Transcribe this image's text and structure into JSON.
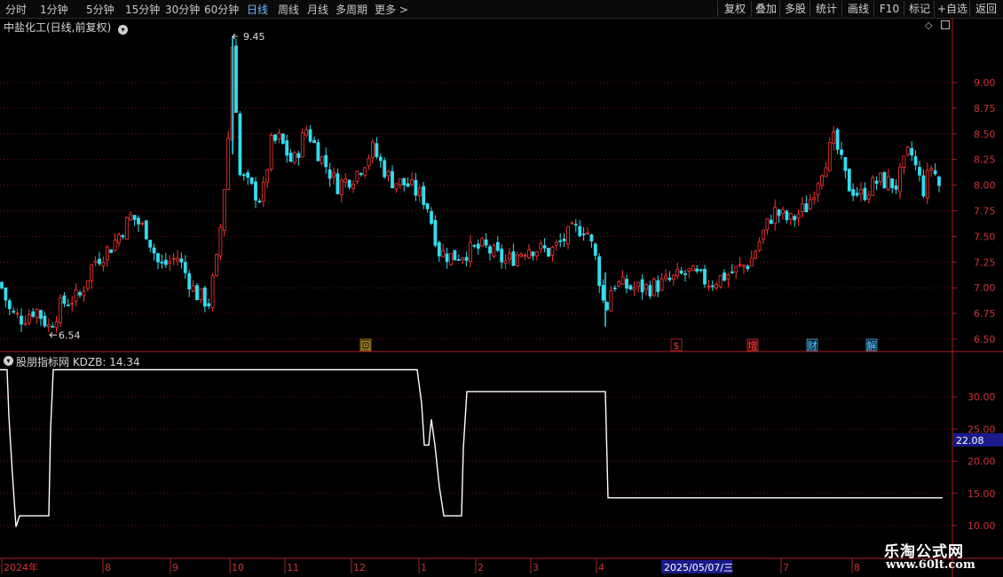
{
  "toolbar": {
    "periods": [
      "分时",
      "1分钟",
      "5分钟",
      "15分钟",
      "30分钟",
      "60分钟",
      "日线",
      "周线",
      "月线",
      "多周期",
      "更多 >"
    ],
    "active_period": "日线",
    "right_buttons": [
      "复权",
      "叠加",
      "多股",
      "统计",
      "画线",
      "F10",
      "标记",
      "+自选",
      "返回"
    ]
  },
  "main_panel": {
    "title": "中盐化工(日线,前复权)",
    "high_label": "9.45",
    "low_label": "6.54",
    "event_markers": [
      "回",
      "$",
      "增",
      "财",
      "解"
    ]
  },
  "sub_panel": {
    "indicator_label": "股朋指标网 KDZB: 14.34",
    "current_value_badge": "22.08"
  },
  "time_axis": {
    "labels": [
      "2024年",
      "8",
      "9",
      "10",
      "11",
      "12",
      "1",
      "2",
      "3",
      "4",
      "7",
      "8"
    ],
    "cursor_date": "2025/05/07/三"
  },
  "colors": {
    "up": "#ff3333",
    "down": "#33ddee",
    "line": "#ffffff",
    "axis": "#cc2222",
    "badge": "#1a1a8a"
  },
  "watermark": {
    "line1": "乐淘公式网",
    "line2": "www.60lt.com"
  },
  "chart_data": [
    {
      "type": "candlestick",
      "title": "中盐化工(日线,前复权)",
      "yticks": [
        6.5,
        6.75,
        7.0,
        7.25,
        7.5,
        7.75,
        8.0,
        8.25,
        8.5,
        8.75,
        9.0
      ],
      "ylim": [
        6.4,
        9.5
      ],
      "grid": true,
      "annotations": [
        {
          "label": "9.45",
          "value": 9.45
        },
        {
          "label": "6.54",
          "value": 6.54
        }
      ],
      "close_path": [
        {
          "x": 0,
          "y": 7.05
        },
        {
          "x": 12,
          "y": 6.75
        },
        {
          "x": 25,
          "y": 6.7
        },
        {
          "x": 40,
          "y": 6.8
        },
        {
          "x": 55,
          "y": 6.62
        },
        {
          "x": 70,
          "y": 6.85
        },
        {
          "x": 90,
          "y": 6.92
        },
        {
          "x": 105,
          "y": 7.25
        },
        {
          "x": 125,
          "y": 7.4
        },
        {
          "x": 148,
          "y": 7.7
        },
        {
          "x": 165,
          "y": 7.55
        },
        {
          "x": 180,
          "y": 7.2
        },
        {
          "x": 200,
          "y": 7.3
        },
        {
          "x": 220,
          "y": 6.95
        },
        {
          "x": 235,
          "y": 6.85
        },
        {
          "x": 245,
          "y": 7.3
        },
        {
          "x": 252,
          "y": 7.9
        },
        {
          "x": 258,
          "y": 8.55
        },
        {
          "x": 262,
          "y": 9.45
        },
        {
          "x": 270,
          "y": 8.1
        },
        {
          "x": 285,
          "y": 7.95
        },
        {
          "x": 295,
          "y": 7.85
        },
        {
          "x": 305,
          "y": 8.4
        },
        {
          "x": 315,
          "y": 8.45
        },
        {
          "x": 330,
          "y": 8.2
        },
        {
          "x": 345,
          "y": 8.55
        },
        {
          "x": 360,
          "y": 8.3
        },
        {
          "x": 380,
          "y": 8.0
        },
        {
          "x": 400,
          "y": 8.1
        },
        {
          "x": 420,
          "y": 8.35
        },
        {
          "x": 440,
          "y": 8.05
        },
        {
          "x": 460,
          "y": 8.0
        },
        {
          "x": 480,
          "y": 7.85
        },
        {
          "x": 495,
          "y": 7.35
        },
        {
          "x": 510,
          "y": 7.3
        },
        {
          "x": 525,
          "y": 7.35
        },
        {
          "x": 545,
          "y": 7.4
        },
        {
          "x": 570,
          "y": 7.25
        },
        {
          "x": 595,
          "y": 7.4
        },
        {
          "x": 620,
          "y": 7.35
        },
        {
          "x": 645,
          "y": 7.55
        },
        {
          "x": 660,
          "y": 7.6
        },
        {
          "x": 672,
          "y": 7.25
        },
        {
          "x": 682,
          "y": 6.75
        },
        {
          "x": 690,
          "y": 7.05
        },
        {
          "x": 710,
          "y": 7.0
        },
        {
          "x": 730,
          "y": 7.0
        },
        {
          "x": 750,
          "y": 7.05
        },
        {
          "x": 775,
          "y": 7.15
        },
        {
          "x": 800,
          "y": 7.05
        },
        {
          "x": 825,
          "y": 7.15
        },
        {
          "x": 845,
          "y": 7.25
        },
        {
          "x": 858,
          "y": 7.5
        },
        {
          "x": 872,
          "y": 7.75
        },
        {
          "x": 890,
          "y": 7.65
        },
        {
          "x": 910,
          "y": 7.8
        },
        {
          "x": 925,
          "y": 8.15
        },
        {
          "x": 940,
          "y": 8.45
        },
        {
          "x": 955,
          "y": 8.0
        },
        {
          "x": 970,
          "y": 7.9
        },
        {
          "x": 990,
          "y": 8.05
        },
        {
          "x": 1010,
          "y": 8.0
        },
        {
          "x": 1025,
          "y": 8.35
        },
        {
          "x": 1040,
          "y": 7.95
        },
        {
          "x": 1050,
          "y": 8.2
        },
        {
          "x": 1062,
          "y": 7.9
        }
      ]
    },
    {
      "type": "line",
      "title": "股朋指标网 KDZB: 14.34",
      "yticks": [
        10.0,
        15.0,
        20.0,
        25.0,
        30.0
      ],
      "ylim": [
        8,
        36
      ],
      "grid": true,
      "series": [
        {
          "name": "KDZB",
          "x": [
            0,
            8,
            10,
            14,
            18,
            22,
            55,
            57,
            60,
            470,
            475,
            478,
            483,
            486,
            490,
            495,
            500,
            505,
            520,
            522,
            526,
            682,
            685,
            1062
          ],
          "y": [
            34.2,
            34.2,
            27,
            18,
            9.8,
            11.5,
            11.5,
            25,
            34.2,
            34.2,
            29,
            22.5,
            22.5,
            26.5,
            22.5,
            16,
            11.5,
            11.5,
            11.5,
            22,
            30.8,
            30.8,
            14.3,
            14.3
          ]
        }
      ]
    }
  ]
}
